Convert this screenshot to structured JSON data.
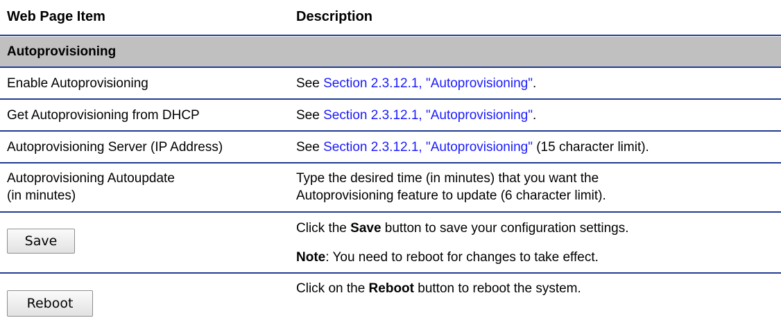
{
  "header": {
    "col1": "Web Page Item",
    "col2": "Description"
  },
  "section_title": "Autoprovisioning",
  "rows": [
    {
      "item": "Enable Autoprovisioning",
      "see": "See ",
      "link": "Section 2.3.12.1, \"Autoprovisioning\"",
      "after": "."
    },
    {
      "item": "Get Autoprovisioning from DHCP",
      "see": "See ",
      "link": "Section 2.3.12.1, \"Autoprovisioning\"",
      "after": "."
    },
    {
      "item": "Autoprovisioning Server (IP Address)",
      "see": "See ",
      "link": "Section 2.3.12.1, \"Autoprovisioning\"",
      "after": " (15 character limit)."
    },
    {
      "item_line1": "Autoprovisioning Autoupdate",
      "item_line2": "(in minutes)",
      "desc_line1": "Type the desired time (in minutes) that you want the",
      "desc_line2": "Autoprovisioning feature to update (6 character limit)."
    }
  ],
  "save": {
    "button_label": "Save",
    "desc_pre": "Click the ",
    "desc_bold": "Save",
    "desc_post": " button to save your configuration settings.",
    "note_bold": "Note",
    "note_text": ": You need to reboot for changes to take effect."
  },
  "reboot": {
    "button_label": "Reboot",
    "desc_pre": "Click on the ",
    "desc_bold": "Reboot",
    "desc_post": " button to reboot the system."
  }
}
